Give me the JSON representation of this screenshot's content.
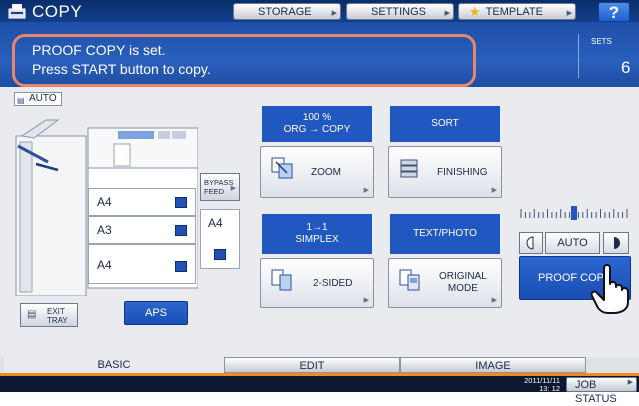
{
  "header": {
    "title": "COPY",
    "storage_label": "STORAGE",
    "settings_label": "SETTINGS",
    "template_label": "TEMPLATE",
    "help_label": "?"
  },
  "message": {
    "line1": "PROOF COPY is set.",
    "line2": "Press START button to copy.",
    "sets_label": "SETS",
    "sets_value": "6"
  },
  "paper": {
    "auto_label": "AUTO",
    "trays": [
      "A4",
      "A3",
      "A4"
    ],
    "bypass_label_1": "BYPASS",
    "bypass_label_2": "FEED",
    "bypass_paper": "A4",
    "exit_tray_1": "EXIT",
    "exit_tray_2": "TRAY",
    "aps_label": "APS"
  },
  "functions": {
    "zoom_header_1": "100 %",
    "zoom_header_2": "ORG  →  COPY",
    "zoom_label": "ZOOM",
    "sort_header": "SORT",
    "finishing_label": "FINISHING",
    "duplex_header_1": "1→1",
    "duplex_header_2": "SIMPLEX",
    "duplex_label": "2-SIDED",
    "mode_header": "TEXT/PHOTO",
    "mode_label_1": "ORIGINAL",
    "mode_label_2": "MODE"
  },
  "density": {
    "auto_label": "AUTO",
    "level": 4,
    "steps": 9
  },
  "proof_copy_label": "PROOF COPY",
  "tabs": [
    "BASIC",
    "EDIT",
    "IMAGE"
  ],
  "footer": {
    "date": "2011/11/11",
    "time": "13: 12",
    "job_status_label": "JOB STATUS"
  },
  "colors": {
    "accent_blue": "#2157c0",
    "highlight": "#e8876a",
    "tab_orange": "#ef8a1f"
  }
}
